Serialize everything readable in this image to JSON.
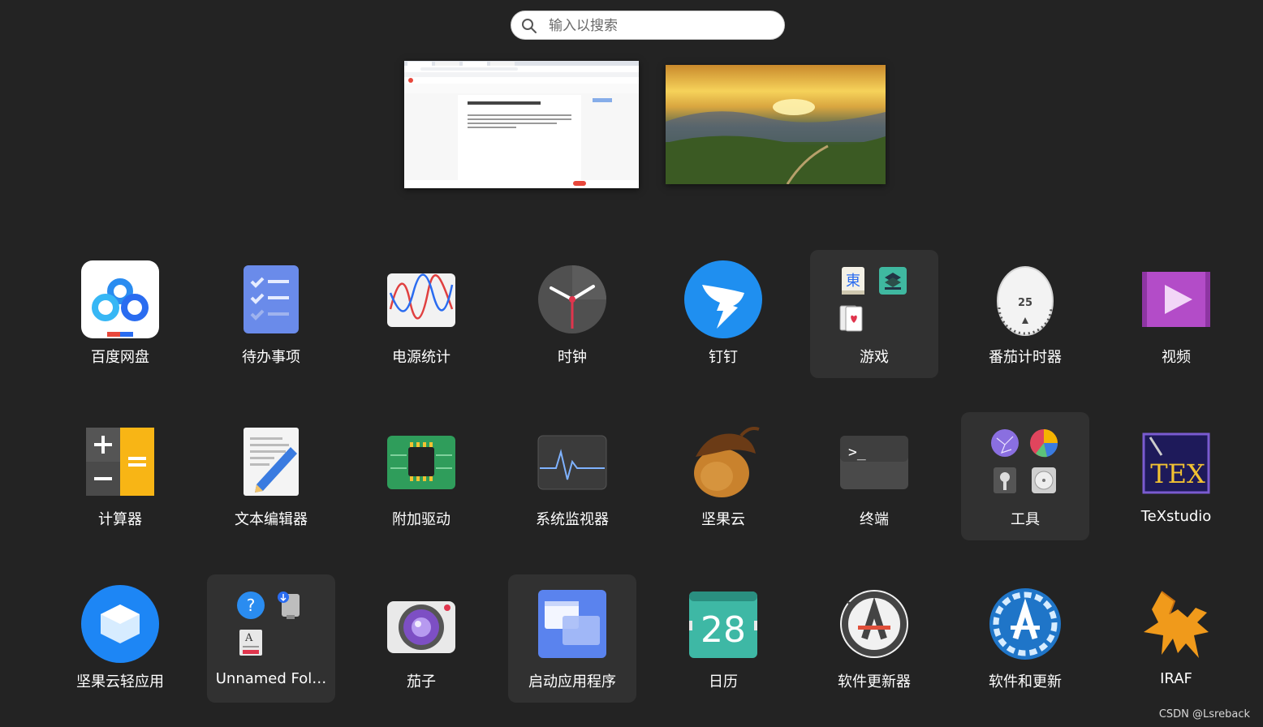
{
  "search": {
    "placeholder": "输入以搜索",
    "icon": "search-icon"
  },
  "windows": [
    {
      "name": "browser-window-preview",
      "title": "天神畅聊工具Barrier在Ubuntu下开机自启动"
    },
    {
      "name": "wallpaper-window-preview"
    }
  ],
  "apps": [
    {
      "label": "百度网盘",
      "icon": "baidu-netdisk-icon"
    },
    {
      "label": "待办事项",
      "icon": "todo-icon"
    },
    {
      "label": "电源统计",
      "icon": "power-statistics-icon"
    },
    {
      "label": "时钟",
      "icon": "clock-icon"
    },
    {
      "label": "钉钉",
      "icon": "dingtalk-icon"
    },
    {
      "label": "游戏",
      "icon": "games-folder-icon"
    },
    {
      "label": "番茄计时器",
      "icon": "tomato-timer-icon",
      "badge": "25"
    },
    {
      "label": "视频",
      "icon": "videos-icon"
    },
    {
      "label": "计算器",
      "icon": "calculator-icon"
    },
    {
      "label": "文本编辑器",
      "icon": "text-editor-icon"
    },
    {
      "label": "附加驱动",
      "icon": "additional-drivers-icon"
    },
    {
      "label": "系统监视器",
      "icon": "system-monitor-icon"
    },
    {
      "label": "坚果云",
      "icon": "nutstore-icon"
    },
    {
      "label": "终端",
      "icon": "terminal-icon",
      "prompt": ">_"
    },
    {
      "label": "工具",
      "icon": "utilities-folder-icon"
    },
    {
      "label": "TeXstudio",
      "icon": "texstudio-icon",
      "logo": "TEX"
    },
    {
      "label": "坚果云轻应用",
      "icon": "nutstore-lite-icon"
    },
    {
      "label": "Unnamed Fol…",
      "icon": "unnamed-folder-icon"
    },
    {
      "label": "茄子",
      "icon": "cheese-icon"
    },
    {
      "label": "启动应用程序",
      "icon": "startup-apps-icon"
    },
    {
      "label": "日历",
      "icon": "calendar-icon",
      "day": "28"
    },
    {
      "label": "软件更新器",
      "icon": "software-updater-icon"
    },
    {
      "label": "软件和更新",
      "icon": "software-and-updates-icon"
    },
    {
      "label": "IRAF",
      "icon": "iraf-icon"
    }
  ],
  "watermark": "CSDN @Lsreback",
  "colors": {
    "background": "#232323",
    "folder_highlight": "#313131",
    "text": "#ffffff"
  }
}
